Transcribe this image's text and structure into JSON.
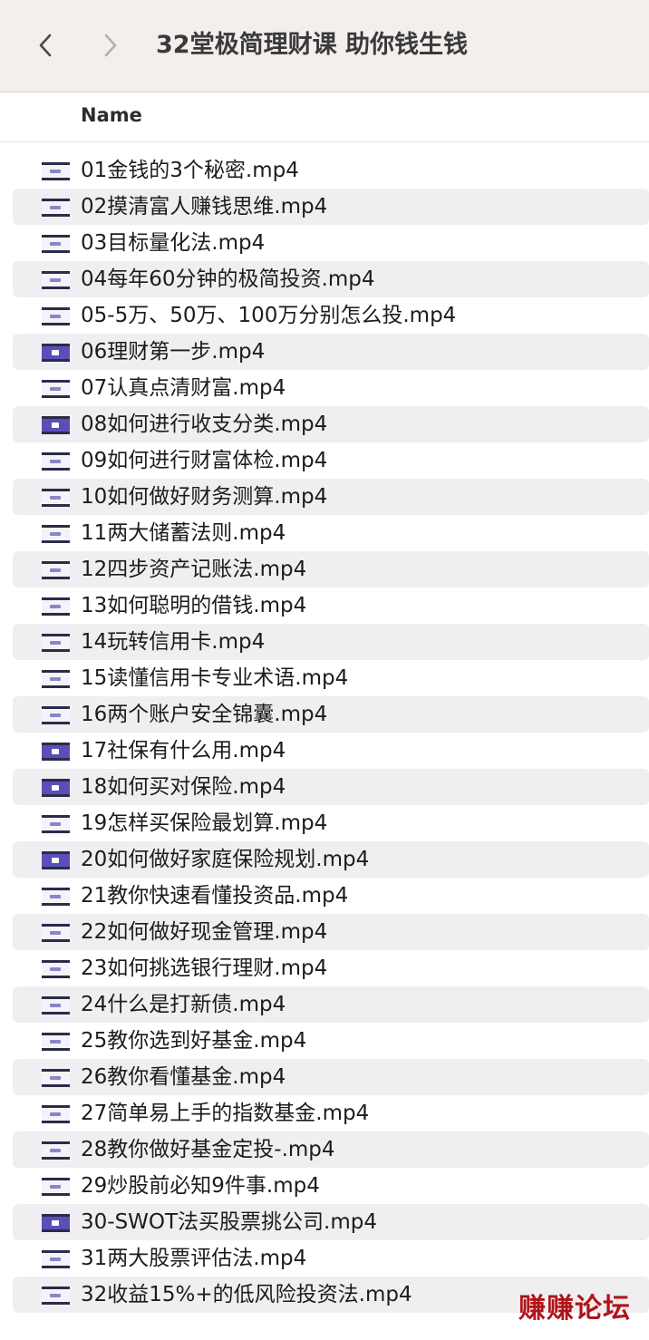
{
  "window": {
    "title": "32堂极简理财课 助你钱生钱",
    "back_icon": "chevron-left-icon",
    "forward_icon": "chevron-right-icon"
  },
  "header": {
    "name_label": "Name"
  },
  "files": [
    {
      "name": "01金钱的3个秘密.mp4",
      "thumb": "light"
    },
    {
      "name": "02摸清富人赚钱思维.mp4",
      "thumb": "light"
    },
    {
      "name": "03目标量化法.mp4",
      "thumb": "light"
    },
    {
      "name": "04每年60分钟的极简投资.mp4",
      "thumb": "light"
    },
    {
      "name": "05-5万、50万、100万分别怎么投.mp4",
      "thumb": "light"
    },
    {
      "name": "06理财第一步.mp4",
      "thumb": "dark"
    },
    {
      "name": "07认真点清财富.mp4",
      "thumb": "light"
    },
    {
      "name": "08如何进行收支分类.mp4",
      "thumb": "dark"
    },
    {
      "name": "09如何进行财富体检.mp4",
      "thumb": "light"
    },
    {
      "name": "10如何做好财务测算.mp4",
      "thumb": "light"
    },
    {
      "name": "11两大储蓄法则.mp4",
      "thumb": "light"
    },
    {
      "name": "12四步资产记账法.mp4",
      "thumb": "light"
    },
    {
      "name": "13如何聪明的借钱.mp4",
      "thumb": "light"
    },
    {
      "name": "14玩转信用卡.mp4",
      "thumb": "light"
    },
    {
      "name": "15读懂信用卡专业术语.mp4",
      "thumb": "light"
    },
    {
      "name": "16两个账户安全锦囊.mp4",
      "thumb": "light"
    },
    {
      "name": "17社保有什么用.mp4",
      "thumb": "dark"
    },
    {
      "name": "18如何买对保险.mp4",
      "thumb": "dark"
    },
    {
      "name": "19怎样买保险最划算.mp4",
      "thumb": "light"
    },
    {
      "name": "20如何做好家庭保险规划.mp4",
      "thumb": "dark"
    },
    {
      "name": "21教你快速看懂投资品.mp4",
      "thumb": "light"
    },
    {
      "name": "22如何做好现金管理.mp4",
      "thumb": "light"
    },
    {
      "name": "23如何挑选银行理财.mp4",
      "thumb": "light"
    },
    {
      "name": "24什么是打新债.mp4",
      "thumb": "light"
    },
    {
      "name": "25教你选到好基金.mp4",
      "thumb": "light"
    },
    {
      "name": "26教你看懂基金.mp4",
      "thumb": "light"
    },
    {
      "name": "27简单易上手的指数基金.mp4",
      "thumb": "light"
    },
    {
      "name": "28教你做好基金定投-.mp4",
      "thumb": "light"
    },
    {
      "name": "29炒股前必知9件事.mp4",
      "thumb": "light"
    },
    {
      "name": "30-SWOT法买股票挑公司.mp4",
      "thumb": "dark"
    },
    {
      "name": "31两大股票评估法.mp4",
      "thumb": "light"
    },
    {
      "name": "32收益15%+的低风险投资法.mp4",
      "thumb": "light"
    }
  ],
  "watermark": "赚赚论坛"
}
